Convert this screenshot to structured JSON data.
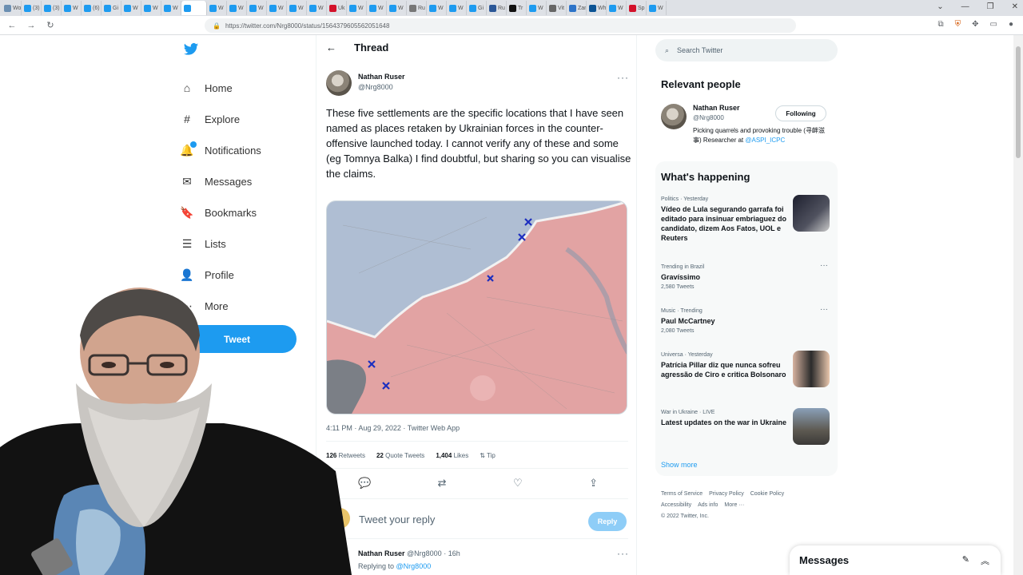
{
  "browser": {
    "tabs": [
      {
        "label": "Wo",
        "color": "#6b8fb2"
      },
      {
        "label": "(3)",
        "color": "#1d9bf0"
      },
      {
        "label": "(3)",
        "color": "#1d9bf0"
      },
      {
        "label": "W",
        "color": "#1d9bf0"
      },
      {
        "label": "(6)",
        "color": "#1d9bf0"
      },
      {
        "label": "Gi",
        "color": "#1d9bf0"
      },
      {
        "label": "W",
        "color": "#1d9bf0"
      },
      {
        "label": "W",
        "color": "#1d9bf0"
      },
      {
        "label": "W",
        "color": "#1d9bf0"
      },
      {
        "label": "",
        "color": "#1d9bf0"
      },
      {
        "label": "W",
        "color": "#1d9bf0"
      },
      {
        "label": "W",
        "color": "#1d9bf0"
      },
      {
        "label": "W",
        "color": "#1d9bf0"
      },
      {
        "label": "W",
        "color": "#1d9bf0"
      },
      {
        "label": "W",
        "color": "#1d9bf0"
      },
      {
        "label": "W",
        "color": "#1d9bf0"
      },
      {
        "label": "Uk",
        "color": "#d3112a"
      },
      {
        "label": "W",
        "color": "#1d9bf0"
      },
      {
        "label": "W",
        "color": "#1d9bf0"
      },
      {
        "label": "W",
        "color": "#1d9bf0"
      },
      {
        "label": "Ru",
        "color": "#777"
      },
      {
        "label": "W",
        "color": "#1d9bf0"
      },
      {
        "label": "W",
        "color": "#1d9bf0"
      },
      {
        "label": "Gi",
        "color": "#1d9bf0"
      },
      {
        "label": "Ru",
        "color": "#2b5797"
      },
      {
        "label": "Tr",
        "color": "#111"
      },
      {
        "label": "W",
        "color": "#1d9bf0"
      },
      {
        "label": "Vit",
        "color": "#666"
      },
      {
        "label": "Zan",
        "color": "#2d73c8"
      },
      {
        "label": "Wh",
        "color": "#0b5394"
      },
      {
        "label": "W",
        "color": "#1d9bf0"
      },
      {
        "label": "Sp",
        "color": "#d3112a"
      },
      {
        "label": "W",
        "color": "#1d9bf0"
      }
    ],
    "url": "https://twitter.com/Nrg8000/status/1564379605562051648"
  },
  "nav": {
    "items": [
      {
        "label": "Home",
        "icon": "home-icon",
        "glyph": "⌂"
      },
      {
        "label": "Explore",
        "icon": "hash-icon",
        "glyph": "#"
      },
      {
        "label": "Notifications",
        "icon": "bell-icon",
        "glyph": "🔔"
      },
      {
        "label": "Messages",
        "icon": "envelope-icon",
        "glyph": "✉"
      },
      {
        "label": "Bookmarks",
        "icon": "bookmark-icon",
        "glyph": "🔖"
      },
      {
        "label": "Lists",
        "icon": "list-icon",
        "glyph": "☰"
      },
      {
        "label": "Profile",
        "icon": "person-icon",
        "glyph": "👤"
      },
      {
        "label": "More",
        "icon": "more-circle-icon",
        "glyph": "⋯"
      }
    ],
    "tweet_button": "Tweet"
  },
  "thread": {
    "title": "Thread",
    "author_name": "Nathan Ruser",
    "author_handle": "@Nrg8000",
    "text": "These five settlements are the specific locations that I have seen named as places retaken by Ukrainian forces in the counter-offensive launched today. I cannot verify any of these and some (eg Tomnya Balka) I find doubtful, but sharing so you can visualise the claims.",
    "timestamp": "4:11 PM · Aug 29, 2022 · Twitter Web App",
    "retweets_count": "126",
    "retweets_label": "Retweets",
    "quotes_count": "22",
    "quotes_label": "Quote Tweets",
    "likes_count": "1,404",
    "likes_label": "Likes",
    "tip_label": "Tip",
    "reply_placeholder": "Tweet your reply",
    "reply_button": "Reply",
    "reply2_name": "Nathan Ruser",
    "reply2_meta": "@Nrg8000 · 16h",
    "reply2_to_prefix": "Replying to",
    "reply2_to_handle": "@Nrg8000"
  },
  "sidebar": {
    "search_placeholder": "Search Twitter",
    "relevant_title": "Relevant people",
    "rp_name": "Nathan Ruser",
    "rp_handle": "@Nrg8000",
    "rp_bio": "Picking quarrels and provoking trouble (寻衅滋事) Researcher at",
    "rp_bio_link": "@ASPI_ICPC",
    "follow_label": "Following",
    "happening_title": "What's happening",
    "trends": [
      {
        "meta": "Politics · Yesterday",
        "title": "Vídeo de Lula segurando garrafa foi editado para insinuar embriaguez do candidato, dizem Aos Fatos, UOL e Reuters",
        "count": ""
      },
      {
        "meta": "Trending in Brazil",
        "title": "Gravíssimo",
        "count": "2,580 Tweets"
      },
      {
        "meta": "Music · Trending",
        "title": "Paul McCartney",
        "count": "2,080 Tweets"
      },
      {
        "meta": "Universa · Yesterday",
        "title": "Patrícia Pillar diz que nunca sofreu agressão de Ciro e critica Bolsonaro",
        "count": ""
      },
      {
        "meta": "War in Ukraine · LIVE",
        "title": "Latest updates on the war in Ukraine",
        "count": ""
      }
    ],
    "show_more": "Show more",
    "footer_line1": [
      "Terms of Service",
      "Privacy Policy",
      "Cookie Policy"
    ],
    "footer_line2": [
      "Accessibility",
      "Ads info",
      "More ···"
    ],
    "copyright": "© 2022 Twitter, Inc."
  },
  "messages_bar": {
    "label": "Messages"
  }
}
